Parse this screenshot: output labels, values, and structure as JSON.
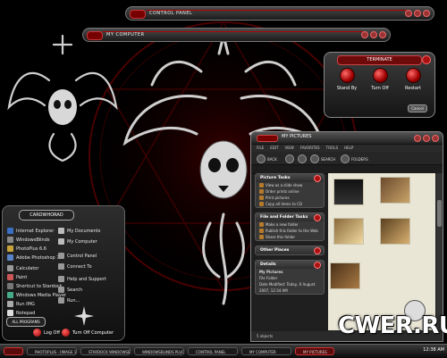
{
  "windows": {
    "control_panel": {
      "title": "CONTROL PANEL"
    },
    "my_computer": {
      "title": "MY COMPUTER"
    }
  },
  "terminate": {
    "title": "TERMINATE",
    "stand_by": "Stand By",
    "turn_off": "Turn Off",
    "restart": "Restart",
    "cancel": "Cancel"
  },
  "start_menu": {
    "user": "CARDWHORAD",
    "left_items": [
      "Internet Explorer",
      "WindowsBlinds",
      "PhotoPlus 6.6",
      "Adobe Photoshop 7.0",
      "Calculator",
      "Paint",
      "Shortcut to Stardock",
      "Windows Media Player",
      "Run IMG",
      "Notepad"
    ],
    "right_items": [
      "My Documents",
      "My Computer",
      "Control Panel",
      "Connect To",
      "Help and Support",
      "Search",
      "Run..."
    ],
    "all_programs": "ALL PROGRAMS",
    "log_off": "Log Off",
    "turn_off": "Turn Off Computer"
  },
  "explorer": {
    "title": "MY PICTURES",
    "menu": [
      "FILE",
      "EDIT",
      "VIEW",
      "FAVORITES",
      "TOOLS",
      "HELP"
    ],
    "toolbar": {
      "back": "BACK",
      "search": "SEARCH",
      "folders": "FOLDERS"
    },
    "panels": {
      "picture_tasks": {
        "title": "Picture Tasks",
        "items": [
          "View as a slide show",
          "Order prints online",
          "Print pictures",
          "Copy all items to CD"
        ]
      },
      "file_folder_tasks": {
        "title": "File and Folder Tasks",
        "items": [
          "Make a new folder",
          "Publish this folder to the Web",
          "Share this folder"
        ]
      },
      "other_places": {
        "title": "Other Places"
      },
      "details": {
        "title": "Details",
        "lines": [
          "My Pictures",
          "File Folder",
          "Date Modified: Today, 6 August",
          "2007, 12:34 AM"
        ]
      }
    },
    "status": "5 objects"
  },
  "taskbar": {
    "buttons": [
      "PHOTOPLUS - [IMAGE 1]",
      "STARDOCK WINDOWSBLINDS",
      "WINDOWSBLINDS PLUGIN",
      "CONTROL PANEL",
      "MY COMPUTER",
      "MY PICTURES"
    ],
    "clock": "12:38 AM"
  },
  "watermark": "CWER.RU",
  "colors": {
    "accent_red": "#b30000",
    "window_dark": "#1f1f1f",
    "content_bg": "#eae6d6"
  }
}
